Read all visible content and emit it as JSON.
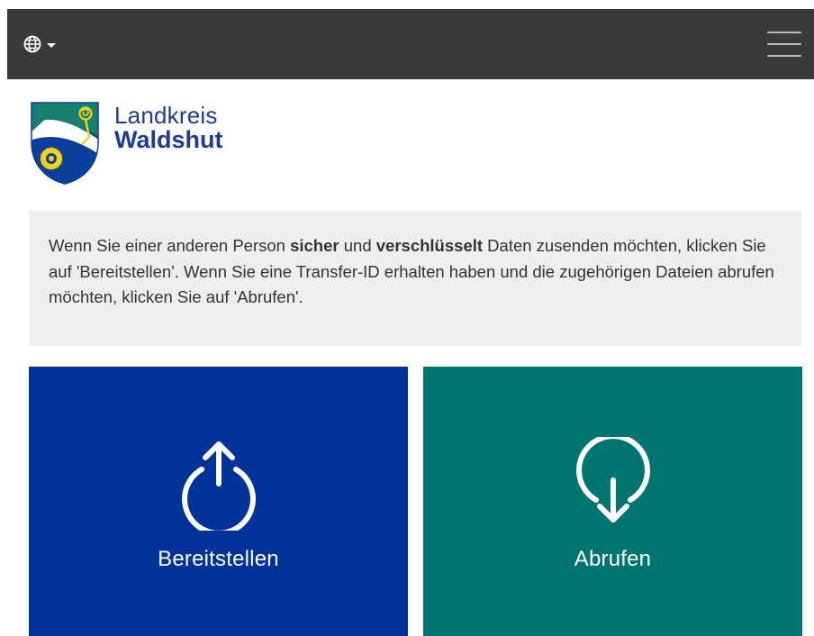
{
  "navbar": {
    "language_icon": "globe-icon",
    "menu_icon": "hamburger-menu-icon"
  },
  "brand": {
    "line1": "Landkreis",
    "line2": "Waldshut",
    "crest_icon": "coat-of-arms-icon"
  },
  "info": {
    "part1": "Wenn Sie einer anderen Person ",
    "bold1": "sicher",
    "part2": " und ",
    "bold2": "verschlüsselt",
    "part3": " Daten zusenden möchten, klicken Sie auf 'Bereitstellen'. Wenn Sie eine Transfer-ID erhalten haben und die zugehörigen Dateien abrufen möchten, klicken Sie auf 'Abrufen'."
  },
  "tiles": [
    {
      "label": "Bereitstellen",
      "icon": "upload-icon",
      "color": "#003399"
    },
    {
      "label": "Abrufen",
      "icon": "download-icon",
      "color": "#00756f"
    }
  ],
  "colors": {
    "navbar": "#3a3a3a",
    "brand_text": "#1d3c96",
    "info_bg": "#eeeeee"
  }
}
